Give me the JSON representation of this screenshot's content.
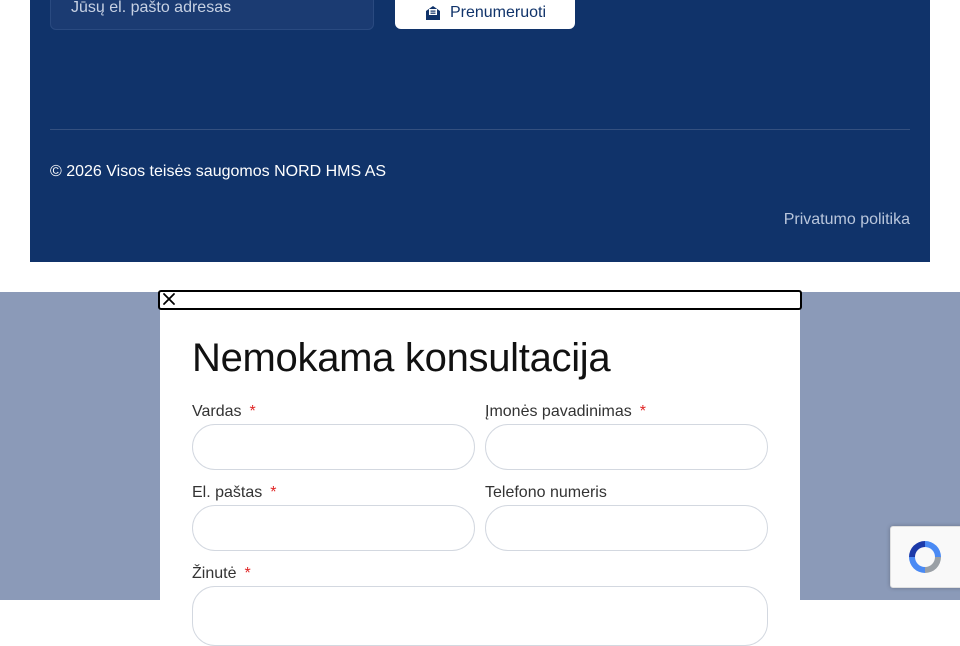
{
  "footer": {
    "email_placeholder": "Jūsų el. pašto adresas",
    "subscribe_label": "Prenumeruoti",
    "copyright": "© 2026 Visos teisės saugomos NORD HMS AS",
    "privacy_label": "Privatumo politika"
  },
  "modal": {
    "close_icon": "close-icon",
    "title": "Nemokama konsultacija",
    "required_mark": "*",
    "fields": {
      "name": "Vardas",
      "company": "Įmonės pavadinimas",
      "email": "El. paštas",
      "phone": "Telefono numeris",
      "message": "Žinutė"
    }
  },
  "colors": {
    "footer_bg": "#10336a",
    "overlay_bg": "#8b9ab8",
    "required": "#e02424"
  }
}
